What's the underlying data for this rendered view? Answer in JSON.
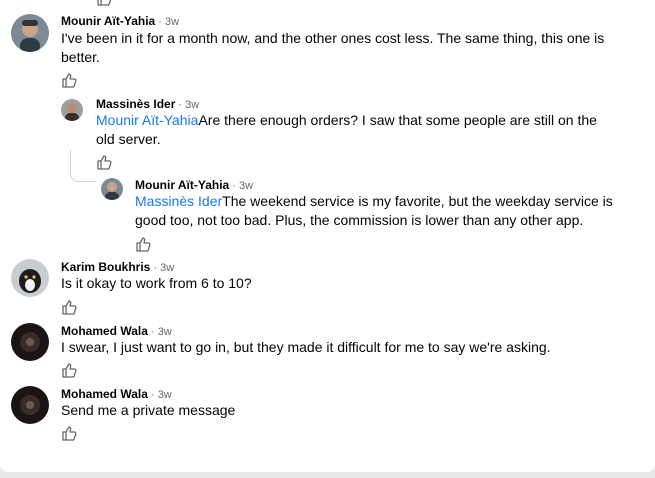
{
  "comments": [
    {
      "author": "Mounir Aït-Yahia",
      "time": "3w",
      "mention": "",
      "text": "I've been in it for a month now, and the other ones cost less. The same thing, this one is better."
    },
    {
      "author": "Massinès Ider",
      "time": "3w",
      "mention": "Mounir Aït-Yahia",
      "text": "Are there enough orders? I saw that some people are still on the old server."
    },
    {
      "author": "Mounir Aït-Yahia",
      "time": "3w",
      "mention": "Massinès Ider",
      "text": "The weekend service is my favorite, but the weekday service is good too, not too bad. Plus, the commission is lower than any other app."
    },
    {
      "author": "Karim Boukhris",
      "time": "3w",
      "mention": "",
      "text": "Is it okay to work from 6 to 10?"
    },
    {
      "author": "Mohamed Wala",
      "time": "3w",
      "mention": "",
      "text": "I swear, I just want to go in, but they made it difficult for me to say we're asking."
    },
    {
      "author": "Mohamed Wala",
      "time": "3w",
      "mention": "",
      "text": "Send me a private message"
    }
  ],
  "separator": " · ",
  "icons": {
    "like": "thumbs-up-icon"
  },
  "colors": {
    "mention": "#1877f2",
    "meta": "#65676b",
    "text": "#050505"
  }
}
